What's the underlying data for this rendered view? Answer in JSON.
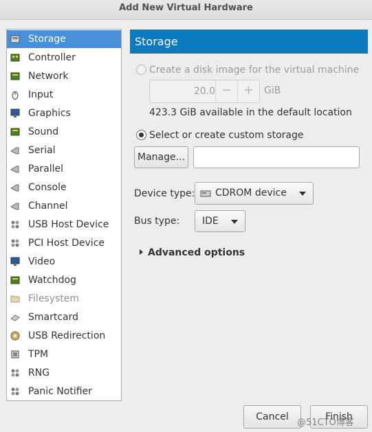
{
  "window": {
    "title": "Add New Virtual Hardware"
  },
  "sidebar": {
    "items": [
      {
        "label": "Storage",
        "icon": "storage-icon",
        "selected": true
      },
      {
        "label": "Controller",
        "icon": "controller-icon"
      },
      {
        "label": "Network",
        "icon": "network-icon"
      },
      {
        "label": "Input",
        "icon": "mouse-icon"
      },
      {
        "label": "Graphics",
        "icon": "monitor-icon"
      },
      {
        "label": "Sound",
        "icon": "sound-card-icon"
      },
      {
        "label": "Serial",
        "icon": "serial-plug-icon"
      },
      {
        "label": "Parallel",
        "icon": "parallel-plug-icon"
      },
      {
        "label": "Console",
        "icon": "console-plug-icon"
      },
      {
        "label": "Channel",
        "icon": "channel-plug-icon"
      },
      {
        "label": "USB Host Device",
        "icon": "usb-icon"
      },
      {
        "label": "PCI Host Device",
        "icon": "pci-icon"
      },
      {
        "label": "Video",
        "icon": "video-monitor-icon"
      },
      {
        "label": "Watchdog",
        "icon": "watchdog-card-icon"
      },
      {
        "label": "Filesystem",
        "icon": "folder-icon",
        "disabled": true
      },
      {
        "label": "Smartcard",
        "icon": "smartcard-icon"
      },
      {
        "label": "USB Redirection",
        "icon": "usb-redirection-icon"
      },
      {
        "label": "TPM",
        "icon": "chip-icon"
      },
      {
        "label": "RNG",
        "icon": "rng-icon"
      },
      {
        "label": "Panic Notifier",
        "icon": "panic-notifier-icon"
      }
    ]
  },
  "main": {
    "header": "Storage",
    "create_disk_label": "Create a disk image for the virtual machine",
    "disk_size": "20.0",
    "minus": "−",
    "plus": "+",
    "unit": "GiB",
    "available": "423.3 GiB available in the default location",
    "custom_storage_label": "Select or create custom storage",
    "manage_button": "Manage...",
    "storage_path_value": "",
    "device_type_label": "Device type:",
    "device_type_value": "CDROM device",
    "bus_type_label": "Bus type:",
    "bus_type_value": "IDE",
    "advanced_options": "Advanced options"
  },
  "footer": {
    "cancel": "Cancel",
    "finish": "Finish",
    "watermark": "@51CTO博客"
  },
  "colors": {
    "selection": "#4a90d9",
    "header": "#0c7abf"
  }
}
